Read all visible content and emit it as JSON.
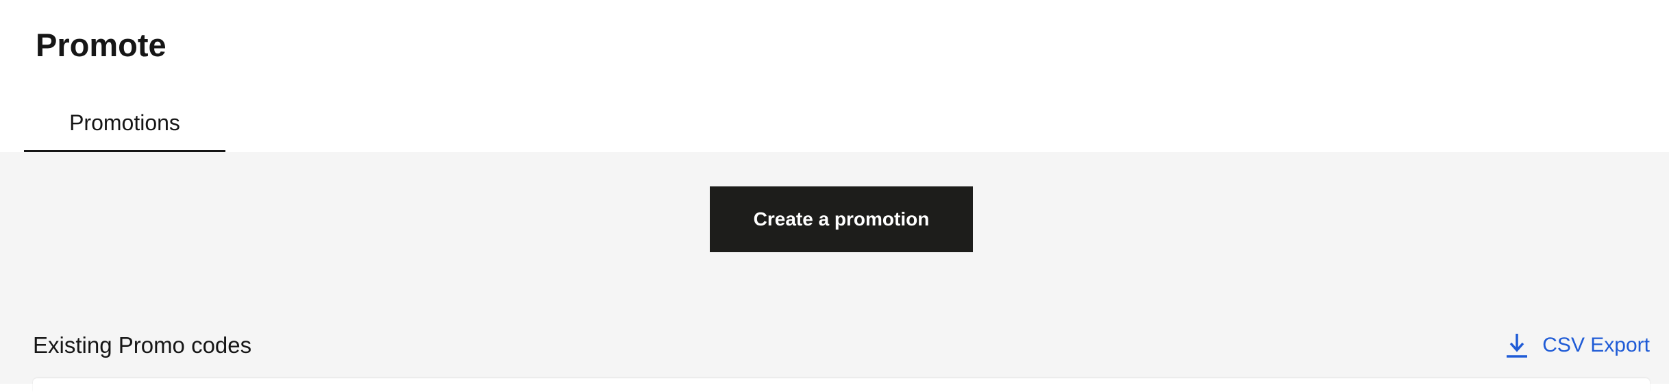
{
  "page": {
    "title": "Promote"
  },
  "tabs": [
    {
      "label": "Promotions",
      "active": true
    }
  ],
  "actions": {
    "create_label": "Create a promotion"
  },
  "promo_codes": {
    "heading": "Existing Promo codes",
    "export_label": "CSV Export",
    "export_icon": "download-icon"
  },
  "colors": {
    "primary_button": "#1d1d1b",
    "link": "#1f5bd6",
    "content_background": "#f5f5f5",
    "tab_indicator": "#161616"
  }
}
